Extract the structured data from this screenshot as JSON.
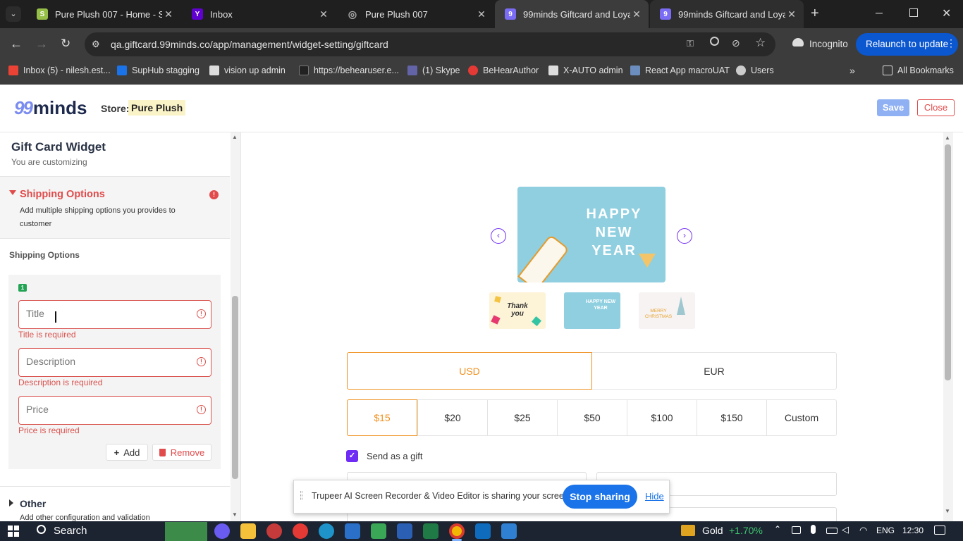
{
  "browser": {
    "tabs": [
      {
        "title": "Pure Plush 007 - Home - Sho",
        "fav_color": "#95bf47",
        "fav_glyph": "S"
      },
      {
        "title": "Inbox",
        "fav_color": "#6001d2",
        "fav_glyph": "Y"
      },
      {
        "title": "Pure Plush 007",
        "fav_color": "#888888",
        "fav_glyph": "◎"
      },
      {
        "title": "99minds Giftcard and Loyalt",
        "fav_color": "#7b6cf6",
        "fav_glyph": "9"
      },
      {
        "title": "99minds Giftcard and Loyalt",
        "fav_color": "#7b6cf6",
        "fav_glyph": "9"
      }
    ],
    "url": "qa.giftcard.99minds.co/app/management/widget-setting/giftcard",
    "incognito_label": "Incognito",
    "relaunch_label": "Relaunch to update",
    "bookmarks": [
      {
        "label": "Inbox (5) - nilesh.est...",
        "color": "#ea4335"
      },
      {
        "label": "SupHub stagging",
        "color": "#1a73e8"
      },
      {
        "label": "vision up admin",
        "color": "#dddddd"
      },
      {
        "label": "https://behearuser.e...",
        "color": "#222222"
      },
      {
        "label": "(1) Skype",
        "color": "#6264a7"
      },
      {
        "label": "BeHearAuthor",
        "color": "#e53935"
      },
      {
        "label": "X-AUTO admin",
        "color": "#dddddd"
      },
      {
        "label": "React App macroUAT",
        "color": "#6c8ebf"
      },
      {
        "label": "Users",
        "color": "#cccccc"
      }
    ],
    "all_bookmarks_label": "All Bookmarks"
  },
  "header": {
    "logo_text": "minds",
    "logo_digits": "99",
    "store_label": "Store:",
    "store_name": "Pure Plush",
    "save_label": "Save",
    "close_label": "Close"
  },
  "sidebar": {
    "widget_title": "Gift Card Widget",
    "widget_subtitle": "You are customizing",
    "section_title": "Shipping Options",
    "section_desc": "Add multiple shipping options you provides to customer",
    "group_label": "Shipping Options",
    "option_badge": "1",
    "title_placeholder": "Title",
    "title_error": "Title is required",
    "desc_placeholder": "Description",
    "desc_error": "Description is required",
    "price_placeholder": "Price",
    "price_error": "Price is required",
    "add_label": "Add",
    "remove_label": "Remove",
    "other_title": "Other",
    "other_desc": "Add other configuration and validation"
  },
  "preview": {
    "card_main_text": "HAPPY NEW YEAR",
    "thumbs": [
      "Thank you",
      "HAPPY NEW YEAR",
      "MERRY CHRISTMAS"
    ],
    "currencies": [
      "USD",
      "EUR"
    ],
    "selected_currency": "USD",
    "amounts": [
      "$15",
      "$20",
      "$25",
      "$50",
      "$100",
      "$150",
      "Custom"
    ],
    "selected_amount": "$15",
    "send_gift_label": "Send as a gift",
    "accent_color": "#f0901e"
  },
  "share_bar": {
    "message": "Trupeer AI Screen Recorder & Video Editor is sharing your screen.",
    "stop_label": "Stop sharing",
    "hide_label": "Hide"
  },
  "taskbar": {
    "search_label": "Search",
    "stock_name": "Gold",
    "stock_change": "+1.70%",
    "lang": "ENG",
    "time": "12:30"
  }
}
